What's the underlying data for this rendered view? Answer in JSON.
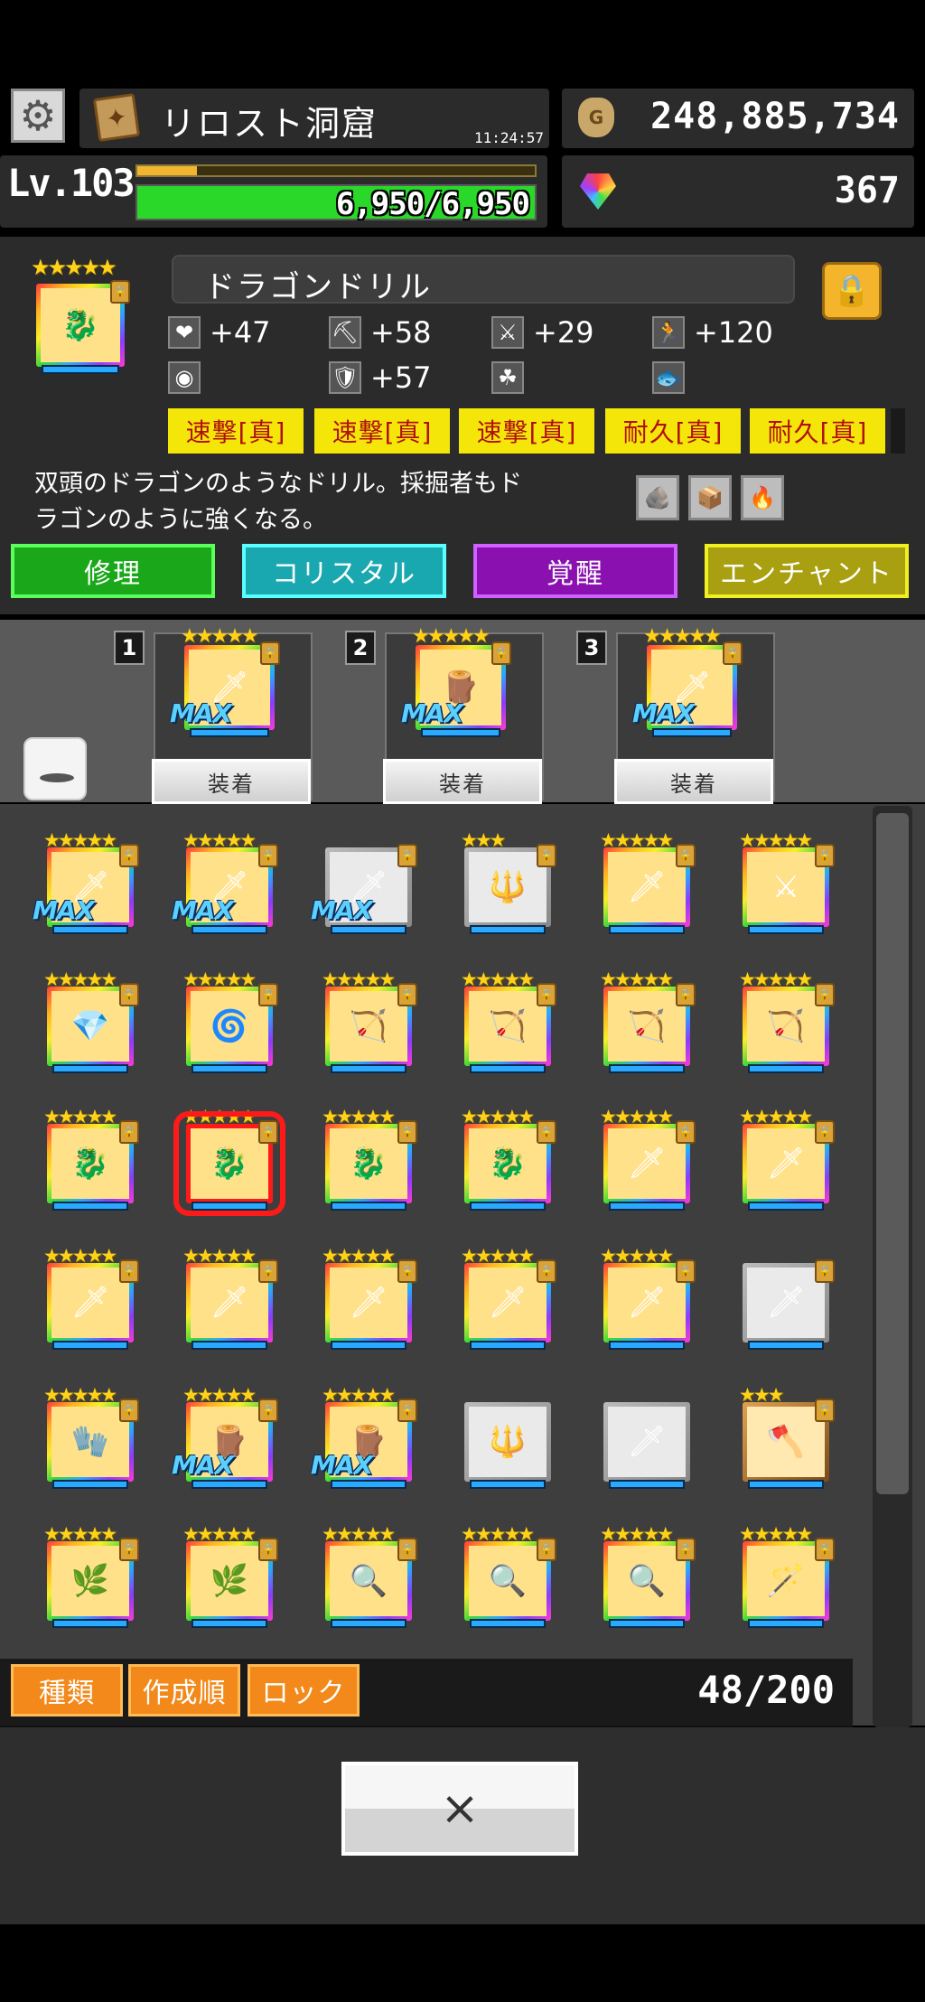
{
  "header": {
    "location_name": "リロスト洞窟",
    "time": "11:24:57",
    "gold": "248,885,734",
    "level": "Lv.103",
    "hp_text": "6,950/6,950",
    "hp_ratio": 1.0,
    "xp_ratio": 0.15,
    "gems": "367"
  },
  "item": {
    "name": "ドラゴンドリル",
    "stars": "★★★★★",
    "stats": [
      {
        "icon": "heart-icon",
        "value": "+47"
      },
      {
        "icon": "pickaxe-icon",
        "value": "+58"
      },
      {
        "icon": "sword-icon",
        "value": "+29"
      },
      {
        "icon": "runner-icon",
        "value": "+120"
      },
      {
        "icon": "target-icon",
        "value": ""
      },
      {
        "icon": "shield-icon",
        "value": "+57"
      },
      {
        "icon": "clover-icon",
        "value": ""
      },
      {
        "icon": "fish-icon",
        "value": ""
      }
    ],
    "tags": [
      "速撃[真]",
      "速撃[真]",
      "速撃[真]",
      "耐久[真]",
      "耐久[真]"
    ],
    "description": "双頭のドラゴンのようなドリル。採掘者もドラゴンのように強くなる。",
    "description_line1": "双頭のドラゴンのようなドリル。採掘者もド",
    "description_line2": "ラゴンのように強くなる。"
  },
  "actions": {
    "repair": "修理",
    "crystal": "コリスタル",
    "awaken": "覚醒",
    "enchant": "エンチャント"
  },
  "slots": [
    {
      "num": "1",
      "max": "MAX",
      "equip": "装着",
      "icon": "🗡"
    },
    {
      "num": "2",
      "max": "MAX",
      "equip": "装着",
      "icon": "🪵"
    },
    {
      "num": "3",
      "max": "MAX",
      "equip": "装着",
      "icon": "🗡"
    }
  ],
  "grid_rows": [
    [
      {
        "stars": "★★★★★",
        "icon": "🗡",
        "frame": "rainbow",
        "max": "MAX",
        "lock": true
      },
      {
        "stars": "★★★★★",
        "icon": "🗡",
        "frame": "rainbow",
        "max": "MAX",
        "lock": true
      },
      {
        "stars": "",
        "icon": "🗡",
        "frame": "silver",
        "max": "MAX",
        "lock": true
      },
      {
        "stars": "★★★",
        "icon": "🔱",
        "frame": "silver",
        "max": "",
        "lock": true
      },
      {
        "stars": "★★★★★",
        "icon": "🗡",
        "frame": "rainbow",
        "max": "",
        "lock": true
      },
      {
        "stars": "★★★★★",
        "icon": "⚔",
        "frame": "rainbow",
        "max": "",
        "lock": true
      }
    ],
    [
      {
        "stars": "★★★★★",
        "icon": "💎",
        "frame": "rainbow",
        "max": "",
        "lock": true
      },
      {
        "stars": "★★★★★",
        "icon": "🌀",
        "frame": "rainbow",
        "max": "",
        "lock": true
      },
      {
        "stars": "★★★★★",
        "icon": "🏹",
        "frame": "rainbow",
        "max": "",
        "lock": true
      },
      {
        "stars": "★★★★★",
        "icon": "🏹",
        "frame": "rainbow",
        "max": "",
        "lock": true
      },
      {
        "stars": "★★★★★",
        "icon": "🏹",
        "frame": "rainbow",
        "max": "",
        "lock": true
      },
      {
        "stars": "★★★★★",
        "icon": "🏹",
        "frame": "rainbow",
        "max": "",
        "lock": true
      }
    ],
    [
      {
        "stars": "★★★★★",
        "icon": "🐉",
        "frame": "rainbow",
        "max": "",
        "lock": true
      },
      {
        "stars": "★★★★★",
        "icon": "🐉",
        "frame": "rainbow",
        "max": "",
        "lock": true,
        "selected": true
      },
      {
        "stars": "★★★★★",
        "icon": "🐉",
        "frame": "rainbow",
        "max": "",
        "lock": true
      },
      {
        "stars": "★★★★★",
        "icon": "🐉",
        "frame": "rainbow",
        "max": "",
        "lock": true
      },
      {
        "stars": "★★★★★",
        "icon": "🗡",
        "frame": "rainbow",
        "max": "",
        "lock": true
      },
      {
        "stars": "★★★★★",
        "icon": "🗡",
        "frame": "rainbow",
        "max": "",
        "lock": true
      }
    ],
    [
      {
        "stars": "★★★★★",
        "icon": "🗡",
        "frame": "rainbow",
        "max": "",
        "lock": true
      },
      {
        "stars": "★★★★★",
        "icon": "🗡",
        "frame": "rainbow",
        "max": "",
        "lock": true
      },
      {
        "stars": "★★★★★",
        "icon": "🗡",
        "frame": "rainbow",
        "max": "",
        "lock": true
      },
      {
        "stars": "★★★★★",
        "icon": "🗡",
        "frame": "rainbow",
        "max": "",
        "lock": true
      },
      {
        "stars": "★★★★★",
        "icon": "🗡",
        "frame": "rainbow",
        "max": "",
        "lock": true
      },
      {
        "stars": "",
        "icon": "🗡",
        "frame": "silver",
        "max": "",
        "lock": true
      }
    ],
    [
      {
        "stars": "★★★★★",
        "icon": "🧤",
        "frame": "rainbow",
        "max": "",
        "lock": true
      },
      {
        "stars": "★★★★★",
        "icon": "🪵",
        "frame": "rainbow",
        "max": "MAX",
        "lock": true
      },
      {
        "stars": "★★★★★",
        "icon": "🪵",
        "frame": "rainbow",
        "max": "MAX",
        "lock": true
      },
      {
        "stars": "",
        "icon": "🔱",
        "frame": "silver",
        "max": "",
        "lock": false
      },
      {
        "stars": "",
        "icon": "🗡",
        "frame": "silver",
        "max": "",
        "lock": false
      },
      {
        "stars": "★★★",
        "icon": "🪓",
        "frame": "bronze",
        "max": "",
        "lock": true
      }
    ],
    [
      {
        "stars": "★★★★★",
        "icon": "🌿",
        "frame": "rainbow",
        "max": "",
        "lock": true
      },
      {
        "stars": "★★★★★",
        "icon": "🌿",
        "frame": "rainbow",
        "max": "",
        "lock": true
      },
      {
        "stars": "★★★★★",
        "icon": "🔍",
        "frame": "rainbow",
        "max": "",
        "lock": true
      },
      {
        "stars": "★★★★★",
        "icon": "🔍",
        "frame": "rainbow",
        "max": "",
        "lock": true
      },
      {
        "stars": "★★★★★",
        "icon": "🔍",
        "frame": "rainbow",
        "max": "",
        "lock": true
      },
      {
        "stars": "★★★★★",
        "icon": "🪄",
        "frame": "rainbow",
        "max": "",
        "lock": true
      }
    ]
  ],
  "bottom": {
    "sort_type": "種類",
    "sort_created": "作成順",
    "lock": "ロック",
    "count": "48/200",
    "close": "×"
  },
  "colors": {
    "repair": "#1aa81a",
    "crystal": "#1aa8b0",
    "awaken": "#8a10b0",
    "enchant": "#a8a010",
    "tag_bg": "#f5e60a",
    "tag_text": "#b01010",
    "hp_fill": "#2ad82a",
    "xp_fill": "#f2b530",
    "sort_btn": "#f2891a",
    "selected": "#ff1a1a"
  }
}
